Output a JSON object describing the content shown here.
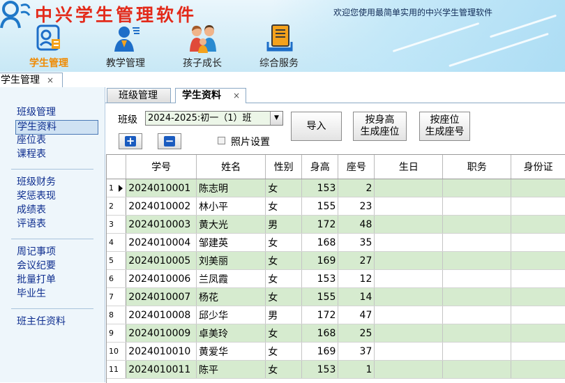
{
  "app": {
    "title": "中兴学生管理软件",
    "welcome": "欢迎您使用最简单实用的中兴学生管理软件"
  },
  "nav": [
    {
      "label": "学生管理",
      "icon": "student-card-icon",
      "active": true
    },
    {
      "label": "教学管理",
      "icon": "teacher-icon",
      "active": false
    },
    {
      "label": "孩子成长",
      "icon": "family-icon",
      "active": false
    },
    {
      "label": "综合服务",
      "icon": "book-icon",
      "active": false
    }
  ],
  "outer_tab": {
    "label": "学生管理",
    "close": "×"
  },
  "sidebar": {
    "groups": [
      [
        "班级管理",
        "学生资料",
        "座位表",
        "课程表"
      ],
      [
        "班级财务",
        "奖惩表现",
        "成绩表",
        "评语表"
      ],
      [
        "周记事项",
        "会议纪要",
        "批量打单",
        "毕业生"
      ],
      [
        "班主任资料"
      ]
    ],
    "selected": "学生资料"
  },
  "inner_tabs": {
    "inactive": "班级管理",
    "active": "学生资料",
    "close": "×"
  },
  "toolbar": {
    "class_label": "班级",
    "class_value": "2024-2025:初一（1）班",
    "add_glyph": "+",
    "remove_glyph": "−",
    "photo_setting": "照片设置",
    "photo_checked": false,
    "import_label": "导入",
    "height_seat_label": [
      "按身高",
      "生成座位"
    ],
    "seat_number_label": [
      "按座位",
      "生成座号"
    ]
  },
  "grid": {
    "columns": [
      "学号",
      "姓名",
      "性别",
      "身高",
      "座号",
      "生日",
      "职务",
      "身份证"
    ],
    "current_row": 1,
    "rows": [
      [
        "1",
        "2024010001",
        "陈志明",
        "女",
        "153",
        "2"
      ],
      [
        "2",
        "2024010002",
        "林小平",
        "女",
        "155",
        "23"
      ],
      [
        "3",
        "2024010003",
        "黄大光",
        "男",
        "172",
        "48"
      ],
      [
        "4",
        "2024010004",
        "邹建英",
        "女",
        "168",
        "35"
      ],
      [
        "5",
        "2024010005",
        "刘美丽",
        "女",
        "169",
        "27"
      ],
      [
        "6",
        "2024010006",
        "兰凤霞",
        "女",
        "153",
        "12"
      ],
      [
        "7",
        "2024010007",
        "杨花",
        "女",
        "155",
        "14"
      ],
      [
        "8",
        "2024010008",
        "邱少华",
        "男",
        "172",
        "47"
      ],
      [
        "9",
        "2024010009",
        "卓美玲",
        "女",
        "168",
        "25"
      ],
      [
        "10",
        "2024010010",
        "黄爱华",
        "女",
        "169",
        "37"
      ],
      [
        "11",
        "2024010011",
        "陈平",
        "女",
        "153",
        "1"
      ]
    ]
  },
  "colors": {
    "title_red": "#e32a1a",
    "active_nav": "#f08a00",
    "sidebar_link": "#0e2e8f",
    "row_green": "#d6ebcf"
  }
}
